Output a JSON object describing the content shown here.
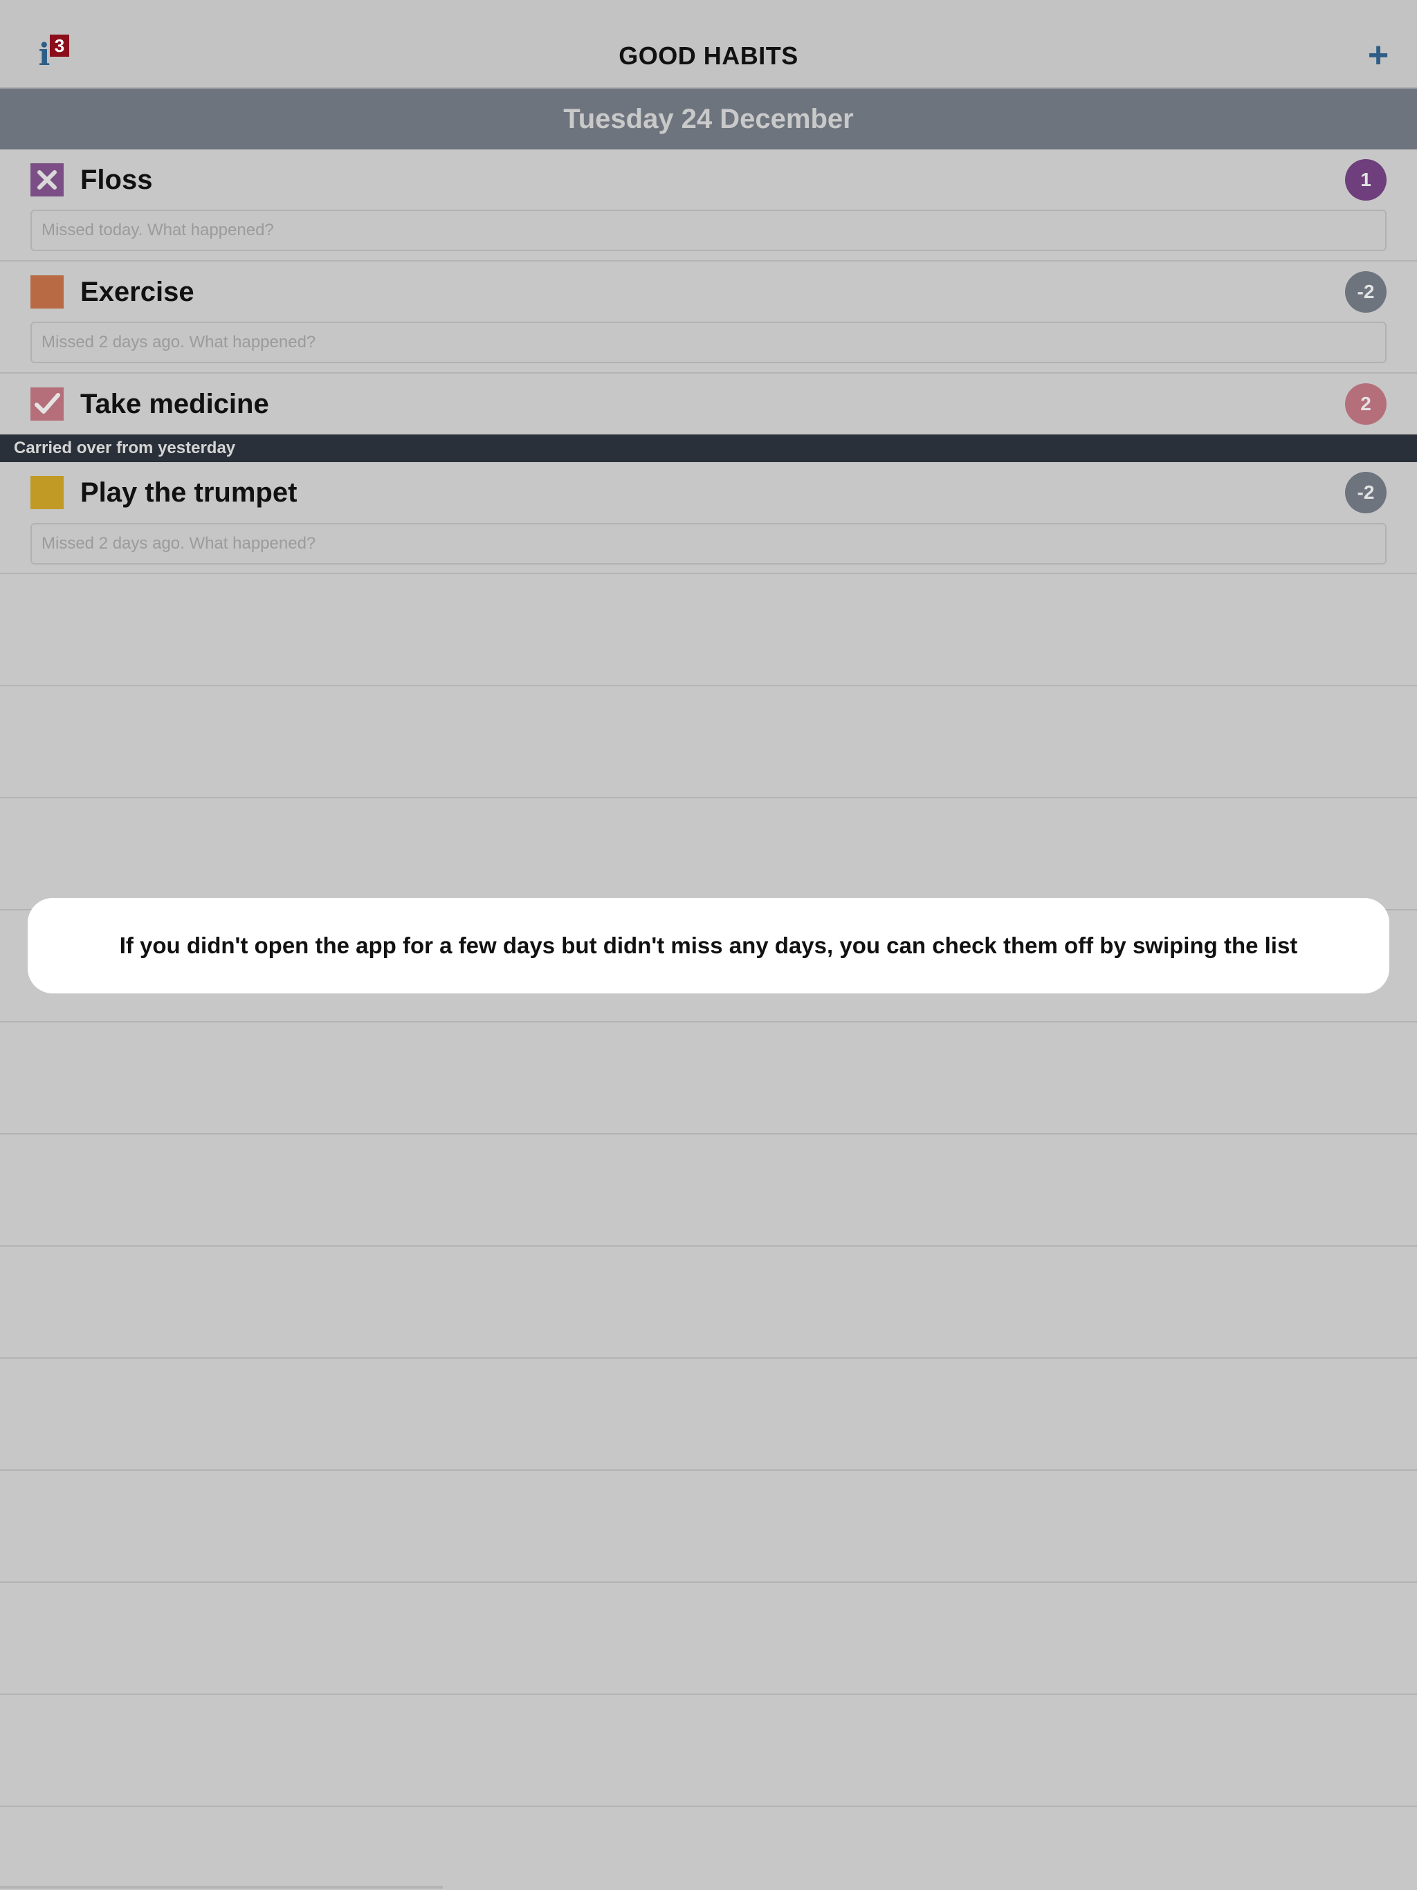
{
  "app": {
    "title": "GOOD HABITS",
    "info_icon": "info-icon",
    "info_badge": "3",
    "add_icon": "plus-icon",
    "add_symbol": "+"
  },
  "date_header": "Tuesday 24 December",
  "habits": [
    {
      "name": "Floss",
      "state": "missed",
      "color": "#7b4f85",
      "streak": "1",
      "streak_color": "#6e3f7c",
      "note_placeholder": "Missed today. What happened?"
    },
    {
      "name": "Exercise",
      "state": "unchecked",
      "color": "#b86a45",
      "streak": "-2",
      "streak_color": "#6d747e",
      "note_placeholder": "Missed 2 days ago. What happened?"
    },
    {
      "name": "Take medicine",
      "state": "done",
      "color": "#b56f7a",
      "streak": "2",
      "streak_color": "#b56f7a"
    }
  ],
  "section": {
    "label": "Carried over from yesterday"
  },
  "carried_habits": [
    {
      "name": "Play the trumpet",
      "state": "unchecked",
      "color": "#c19a25",
      "streak": "-2",
      "streak_color": "#6d747e",
      "note_placeholder": "Missed 2 days ago. What happened?"
    }
  ],
  "tooltip": {
    "text": "If you didn't open the app for a few days but didn't miss any days, you can check them off by swiping the list"
  }
}
